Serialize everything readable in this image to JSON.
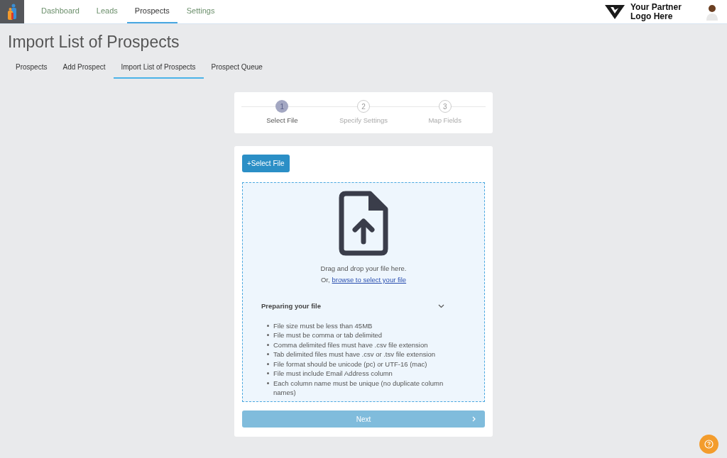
{
  "nav": {
    "items": [
      {
        "label": "Dashboard",
        "selected": false
      },
      {
        "label": "Leads",
        "selected": false
      },
      {
        "label": "Prospects",
        "selected": true
      },
      {
        "label": "Settings",
        "selected": false
      }
    ],
    "partner_logo": "Your Partner Logo Here"
  },
  "page_title": "Import List of Prospects",
  "tabs": [
    {
      "label": "Prospects",
      "selected": false
    },
    {
      "label": "Add Prospect",
      "selected": false
    },
    {
      "label": "Import List of Prospects",
      "selected": true
    },
    {
      "label": "Prospect Queue",
      "selected": false
    }
  ],
  "steps": [
    {
      "number": "1",
      "label": "Select File",
      "selected": true
    },
    {
      "number": "2",
      "label": "Specify Settings",
      "selected": false
    },
    {
      "number": "3",
      "label": "Map Fields",
      "selected": false
    }
  ],
  "select_button": "+Select File",
  "dropzone": {
    "line1": "Drag and drop your file here.",
    "line2_prefix": "Or,",
    "link": "browse to select your file"
  },
  "preparing": {
    "title": "Preparing your file",
    "expanded": true,
    "rules": [
      "File size must be less than 45MB",
      "File must be comma or tab delimited",
      "Comma delimited files must have .csv file extension",
      "Tab delimited files must have .csv or .tsv file extension",
      "File format should be unicode (pc) or UTF-16 (mac)",
      "File must include Email Address column",
      "Each column name must be unique (no duplicate column names)"
    ]
  },
  "next_button": {
    "label": "Next",
    "disabled": true
  }
}
